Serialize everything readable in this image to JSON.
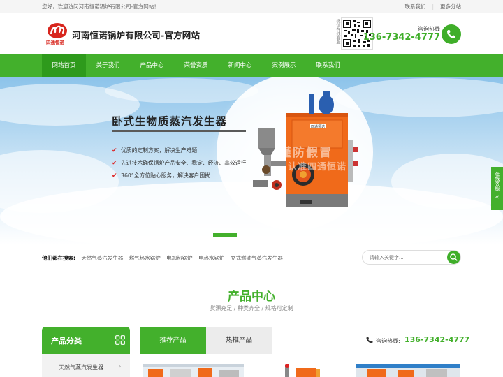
{
  "topbar": {
    "welcome": "您好，欢迎访问河南恒诺锅炉有限公司-官方网站！",
    "links": [
      "联系我们",
      "更多分站"
    ]
  },
  "header": {
    "logo_text": "四通恒诺",
    "title": "河南恒诺锅炉有限公司-官方网站",
    "qr_label": "微信在线客服",
    "hotline_label": "咨询热线",
    "hotline_number": "136-7342-4777"
  },
  "nav": {
    "items": [
      "网站首页",
      "关于我们",
      "产品中心",
      "荣誉资质",
      "新闻中心",
      "案例展示",
      "联系我们"
    ],
    "active_index": 0
  },
  "banner": {
    "title": "卧式生物质蒸汽发生器",
    "features": [
      "优质的定制方案，解决生产难题",
      "先进技术确保锅炉产品安全、稳定、经济、高效运行",
      "360°全方位贴心服务，解决客户困扰"
    ],
    "watermark_1": "谨防假冒",
    "watermark_2": "认准四通恒诺",
    "plate_text": "四通恒诺"
  },
  "side_float": {
    "label": "在线客服"
  },
  "search": {
    "hot_label": "他们都在搜索:",
    "keywords": [
      "天然气蒸汽发生器",
      "燃气热水锅炉",
      "电加热锅炉",
      "电热水锅炉",
      "立式燃油气蒸汽发生器"
    ],
    "placeholder": "请输入关键字..."
  },
  "products": {
    "title": "产品中心",
    "subtitle": "货源充足 / 种类齐全 / 规格可定制",
    "category_head": "产品分类",
    "categories": [
      "天然气蒸汽发生器"
    ],
    "tabs": [
      "推荐产品",
      "热推产品"
    ],
    "hotline_label": "咨询热线:",
    "hotline_number": "136-7342-4777"
  },
  "colors": {
    "brand_green": "#43b02c",
    "nav_active": "#2e9a1c",
    "boiler_orange": "#f06a1a"
  }
}
